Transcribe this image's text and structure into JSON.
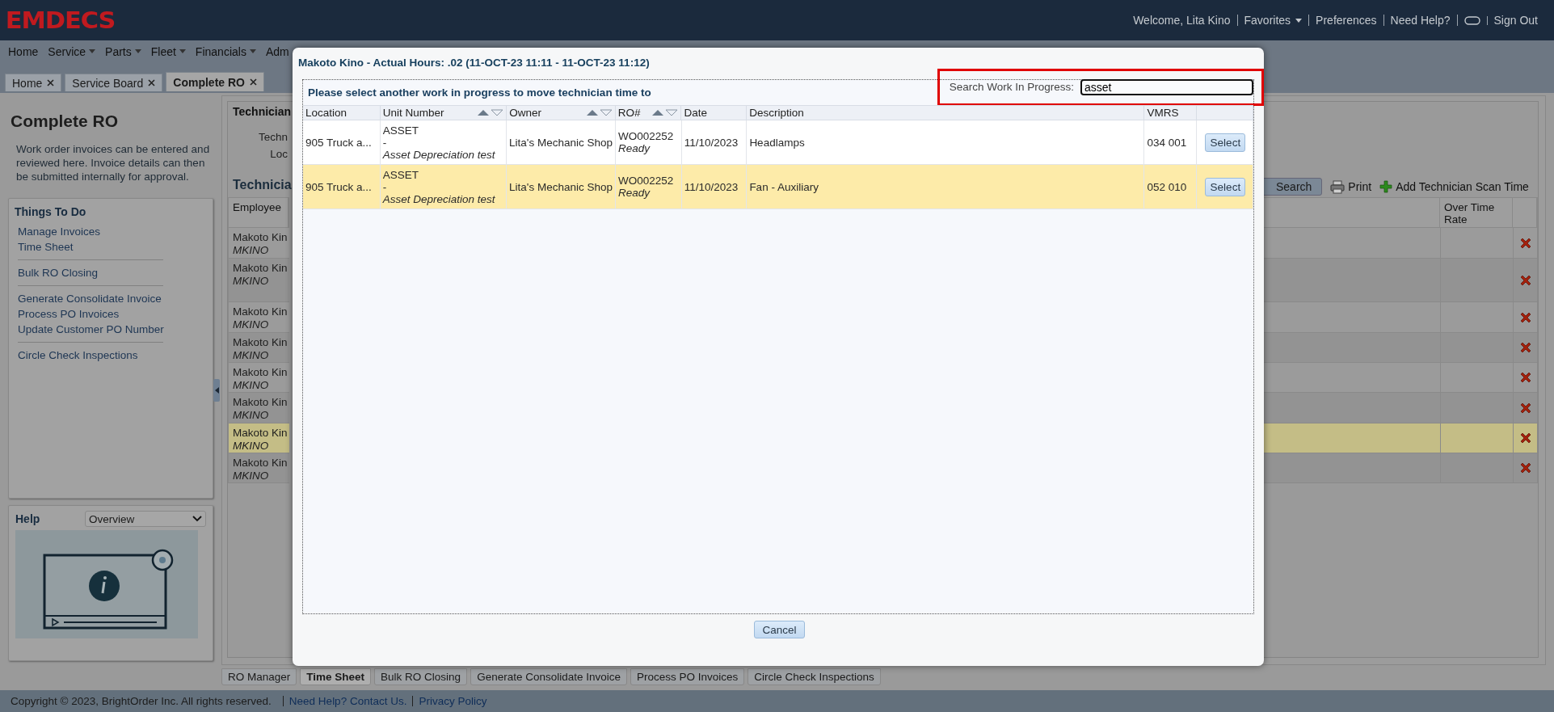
{
  "header": {
    "logo": "EMDECS",
    "links": [
      {
        "kind": "text",
        "label": "Welcome, Lita Kino"
      },
      {
        "kind": "menu",
        "label": "Favorites"
      },
      {
        "kind": "link",
        "label": "Preferences"
      },
      {
        "kind": "link",
        "label": "Need Help?"
      },
      {
        "kind": "toggle"
      },
      {
        "kind": "link",
        "label": "Sign Out"
      }
    ]
  },
  "nav": [
    {
      "label": "Home",
      "dropdown": false
    },
    {
      "label": "Service",
      "dropdown": true
    },
    {
      "label": "Parts",
      "dropdown": true
    },
    {
      "label": "Fleet",
      "dropdown": true
    },
    {
      "label": "Financials",
      "dropdown": true
    },
    {
      "label": "Adm",
      "dropdown": false
    }
  ],
  "tabs": [
    {
      "label": "Home",
      "selected": false
    },
    {
      "label": "Service Board",
      "selected": false
    },
    {
      "label": "Complete RO",
      "selected": true
    }
  ],
  "left_panel": {
    "title": "Complete RO",
    "description": "Work order invoices can be entered and reviewed here. Invoice details can then be submitted internally for approval.",
    "things_to_do": {
      "title": "Things To Do",
      "groups": [
        [
          "Manage Invoices",
          "Time Sheet"
        ],
        [
          "Bulk RO Closing"
        ],
        [
          "Generate Consolidate Invoice",
          "Process PO Invoices",
          "Update Customer PO Number"
        ],
        [
          "Circle Check Inspections"
        ]
      ]
    },
    "help": {
      "title": "Help",
      "select": "Overview"
    }
  },
  "technician_panel": {
    "title": "Technician",
    "fields": [
      "Techn",
      "Loc"
    ],
    "section_title": "Technicia",
    "toolbar": [
      {
        "kind": "search",
        "label": "Search"
      },
      {
        "kind": "print",
        "label": "Print"
      },
      {
        "kind": "add",
        "label": "Add Technician Scan Time"
      }
    ],
    "columns": [
      "Employee",
      "Over Time Rate"
    ],
    "rows": [
      {
        "name": "Makoto Kin",
        "code": "MKINO",
        "selected": false
      },
      {
        "name": "Makoto Kin",
        "code": "MKINO",
        "selected": false
      },
      {
        "name": "Makoto Kin",
        "code": "MKINO",
        "selected": false
      },
      {
        "name": "Makoto Kin",
        "code": "MKINO",
        "selected": false
      },
      {
        "name": "Makoto Kin",
        "code": "MKINO",
        "selected": false
      },
      {
        "name": "Makoto Kin",
        "code": "MKINO",
        "selected": false
      },
      {
        "name": "Makoto Kin",
        "code": "MKINO",
        "selected": true
      },
      {
        "name": "Makoto Kin",
        "code": "MKINO",
        "selected": false
      }
    ]
  },
  "bottom_tabs": [
    {
      "label": "RO Manager",
      "selected": false
    },
    {
      "label": "Time Sheet",
      "selected": true
    },
    {
      "label": "Bulk RO Closing",
      "selected": false
    },
    {
      "label": "Generate Consolidate Invoice",
      "selected": false
    },
    {
      "label": "Process PO Invoices",
      "selected": false
    },
    {
      "label": "Circle Check Inspections",
      "selected": false
    }
  ],
  "footer": {
    "copyright": "Copyright © 2023, BrightOrder Inc. All rights reserved.",
    "links": [
      "Need Help? Contact Us.",
      "Privacy Policy"
    ]
  },
  "dialog": {
    "title": "Makoto Kino - Actual Hours: .02 (11-OCT-23 11:11 - 11-OCT-23 11:12)",
    "prompt": "Please select another work in progress to move technician time to",
    "search": {
      "label": "Search Work In Progress:",
      "value": "asset",
      "highlighted": true
    },
    "columns": [
      {
        "label": "Location",
        "sortable": false
      },
      {
        "label": "Unit Number",
        "sortable": true
      },
      {
        "label": "Owner",
        "sortable": true
      },
      {
        "label": "RO#",
        "sortable": true
      },
      {
        "label": "Date",
        "sortable": false
      },
      {
        "label": "Description",
        "sortable": false
      },
      {
        "label": "VMRS",
        "sortable": false
      }
    ],
    "rows": [
      {
        "location": "905 Truck a...",
        "unit": "ASSET",
        "unit_sep": "-",
        "unit_desc": "Asset Depreciation test",
        "owner": "Lita's Mechanic Shop",
        "ro": "WO002252",
        "status": "Ready",
        "date": "11/10/2023",
        "description": "Headlamps",
        "vmrs": "034 001",
        "action": "Select",
        "selected": false
      },
      {
        "location": "905 Truck a...",
        "unit": "ASSET",
        "unit_sep": "-",
        "unit_desc": "Asset Depreciation test",
        "owner": "Lita's Mechanic Shop",
        "ro": "WO002252",
        "status": "Ready",
        "date": "11/10/2023",
        "description": "Fan - Auxiliary",
        "vmrs": "052 010",
        "action": "Select",
        "selected": true
      }
    ],
    "cancel": "Cancel"
  }
}
